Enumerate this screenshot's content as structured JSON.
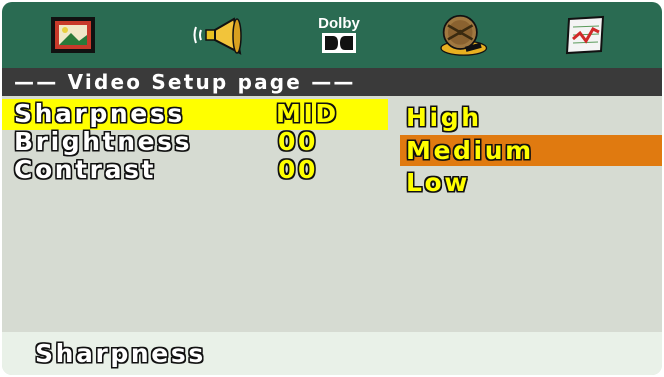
{
  "tabs": [
    {
      "id": "general",
      "icon": "monitor-photo-icon"
    },
    {
      "id": "audio",
      "icon": "speaker-icon"
    },
    {
      "id": "dolby",
      "icon": "dolby-icon",
      "label": "Dolby"
    },
    {
      "id": "video",
      "icon": "film-reel-icon"
    },
    {
      "id": "preference",
      "icon": "chart-check-icon"
    }
  ],
  "header": {
    "title": "—— Video Setup page ——"
  },
  "settings": [
    {
      "label": "Sharpness",
      "value": "MID",
      "selected": true
    },
    {
      "label": "Brightness",
      "value": "00",
      "selected": false
    },
    {
      "label": "Contrast",
      "value": "00",
      "selected": false
    }
  ],
  "options": [
    {
      "label": "High",
      "selected": false
    },
    {
      "label": "Medium",
      "selected": true
    },
    {
      "label": "Low",
      "selected": false
    }
  ],
  "status": {
    "text": "Sharpness"
  },
  "colors": {
    "tab_bar": "#2a6b52",
    "title_bar": "#3a3a3a",
    "panel": "#d6dbd2",
    "row_highlight": "#ffff00",
    "option_highlight": "#e07a10",
    "value_text": "#ffff00",
    "status_bar": "#e9f1e8"
  }
}
